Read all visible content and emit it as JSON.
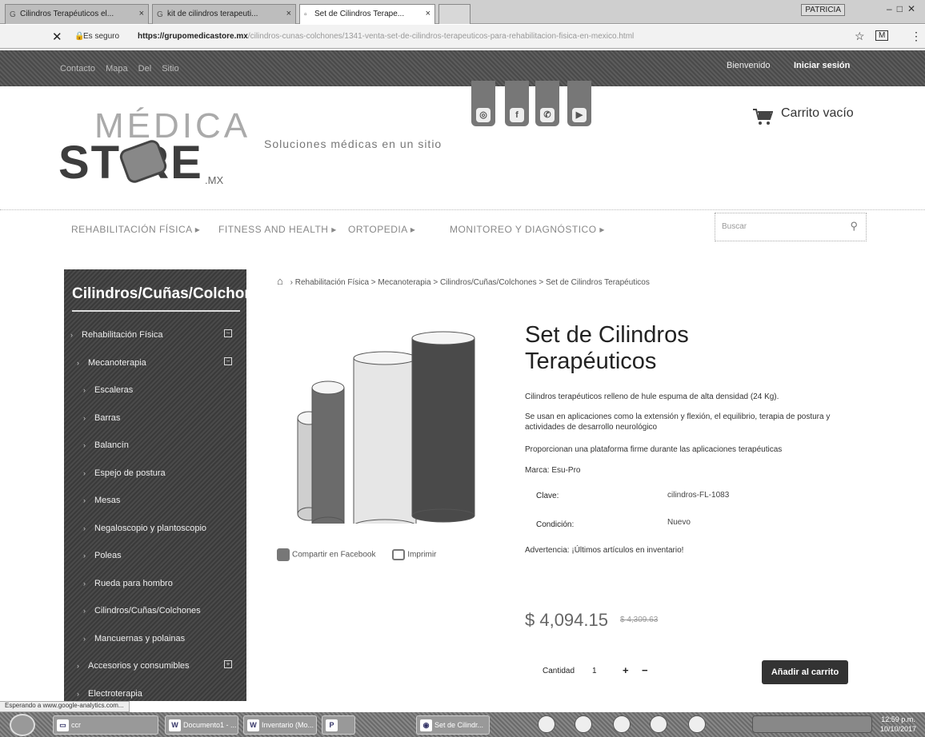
{
  "browser": {
    "tabs": [
      {
        "title": "Cilindros Terapéuticos el..."
      },
      {
        "title": "kit de cilindros terapeuti..."
      },
      {
        "title": "Set de Cilindros Terape..."
      }
    ],
    "secure_label": "Es seguro",
    "url_main": "https://grupomedicastore.mx",
    "url_tail": "/cilindros-cunas-colchones/1341-venta-set-de-cilindros-terapeuticos-para-rehabilitacion-fisica-en-mexico.html",
    "user_badge": "PATRICIA",
    "status_text": "Esperando a www.google-analytics.com..."
  },
  "topbar": {
    "left_links": "Contacto   Mapa Del Sitio",
    "welcome": "Bienvenido",
    "login": "Iniciar sesión"
  },
  "header": {
    "logo_top": "MÉDICA",
    "logo_bottom": "ST  RE",
    "logo_suffix": ".MX",
    "tagline": "Soluciones médicas en un sitio",
    "cart_text": "Carrito vacío",
    "social": [
      {
        "icon": "instagram-icon",
        "glyph": "◎"
      },
      {
        "icon": "facebook-icon",
        "glyph": "f"
      },
      {
        "icon": "whatsapp-icon",
        "glyph": "✆"
      },
      {
        "icon": "youtube-icon",
        "glyph": "▶"
      }
    ]
  },
  "nav": {
    "items": [
      "REHABILITACIÓN FÍSICA  ▸",
      "FITNESS AND HEALTH  ▸",
      "ORTOPEDIA  ▸",
      "MONITOREO Y DIAGNÓSTICO  ▸"
    ],
    "search_placeholder": "Buscar"
  },
  "sidebar": {
    "title": "Cilindros/Cuñas/Colchones",
    "items": [
      {
        "label": "Rehabilitación Física",
        "toggle": "−"
      },
      {
        "label": "Mecanoterapia",
        "toggle": "−"
      },
      {
        "label": "Escaleras",
        "toggle": ""
      },
      {
        "label": "Barras",
        "toggle": ""
      },
      {
        "label": "Balancín",
        "toggle": ""
      },
      {
        "label": "Espejo de postura",
        "toggle": ""
      },
      {
        "label": "Mesas",
        "toggle": ""
      },
      {
        "label": "Negaloscopio y plantoscopio",
        "toggle": ""
      },
      {
        "label": "Poleas",
        "toggle": ""
      },
      {
        "label": "Rueda para hombro",
        "toggle": ""
      },
      {
        "label": "Cilindros/Cuñas/Colchones",
        "toggle": ""
      },
      {
        "label": "Mancuernas y polainas",
        "toggle": ""
      },
      {
        "label": "Accesorios y consumibles",
        "toggle": "+"
      },
      {
        "label": "Electroterapia",
        "toggle": ""
      }
    ]
  },
  "breadcrumb": {
    "path": "›  Rehabilitación Física  >  Mecanoterapia  >  Cilindros/Cuñas/Colchones  >  Set de Cilindros Terapéuticos"
  },
  "product": {
    "title": "Set de Cilindros Terapéuticos",
    "desc1": "Cilindros terapéuticos relleno de hule espuma de alta densidad (24 Kg).",
    "desc2": "Se usan en aplicaciones como la extensión y flexión, el equilibrio, terapia de postura y actividades de desarrollo neurológico",
    "desc3": "Proporcionan una plataforma firme durante las aplicaciones terapéuticas",
    "brand": "Marca: Esu-Pro",
    "clave_label": "Clave:",
    "clave_value": "cilindros-FL-1083",
    "condicion_label": "Condición:",
    "condicion_value": "Nuevo",
    "warning": "Advertencia: ¡Últimos artículos en inventario!",
    "price": "$ 4,094.15",
    "old_price": "$ 4,309.63",
    "share_facebook": "Compartir en Facebook",
    "print": "Imprimir",
    "qty_label": "Cantidad",
    "qty_value": "1",
    "add_to_cart": "Añadir al carrito",
    "cylinder_colors": [
      "#cfcfcf",
      "#6b6b6b",
      "#e6e6e6",
      "#4a4a4a"
    ]
  },
  "taskbar": {
    "buttons": [
      "ccr",
      "Documento1 - ...",
      "Inventario (Mo...",
      "P",
      "Set de Cilindr..."
    ],
    "clock_time": "12:59 p.m.",
    "clock_date": "10/10/2017"
  }
}
